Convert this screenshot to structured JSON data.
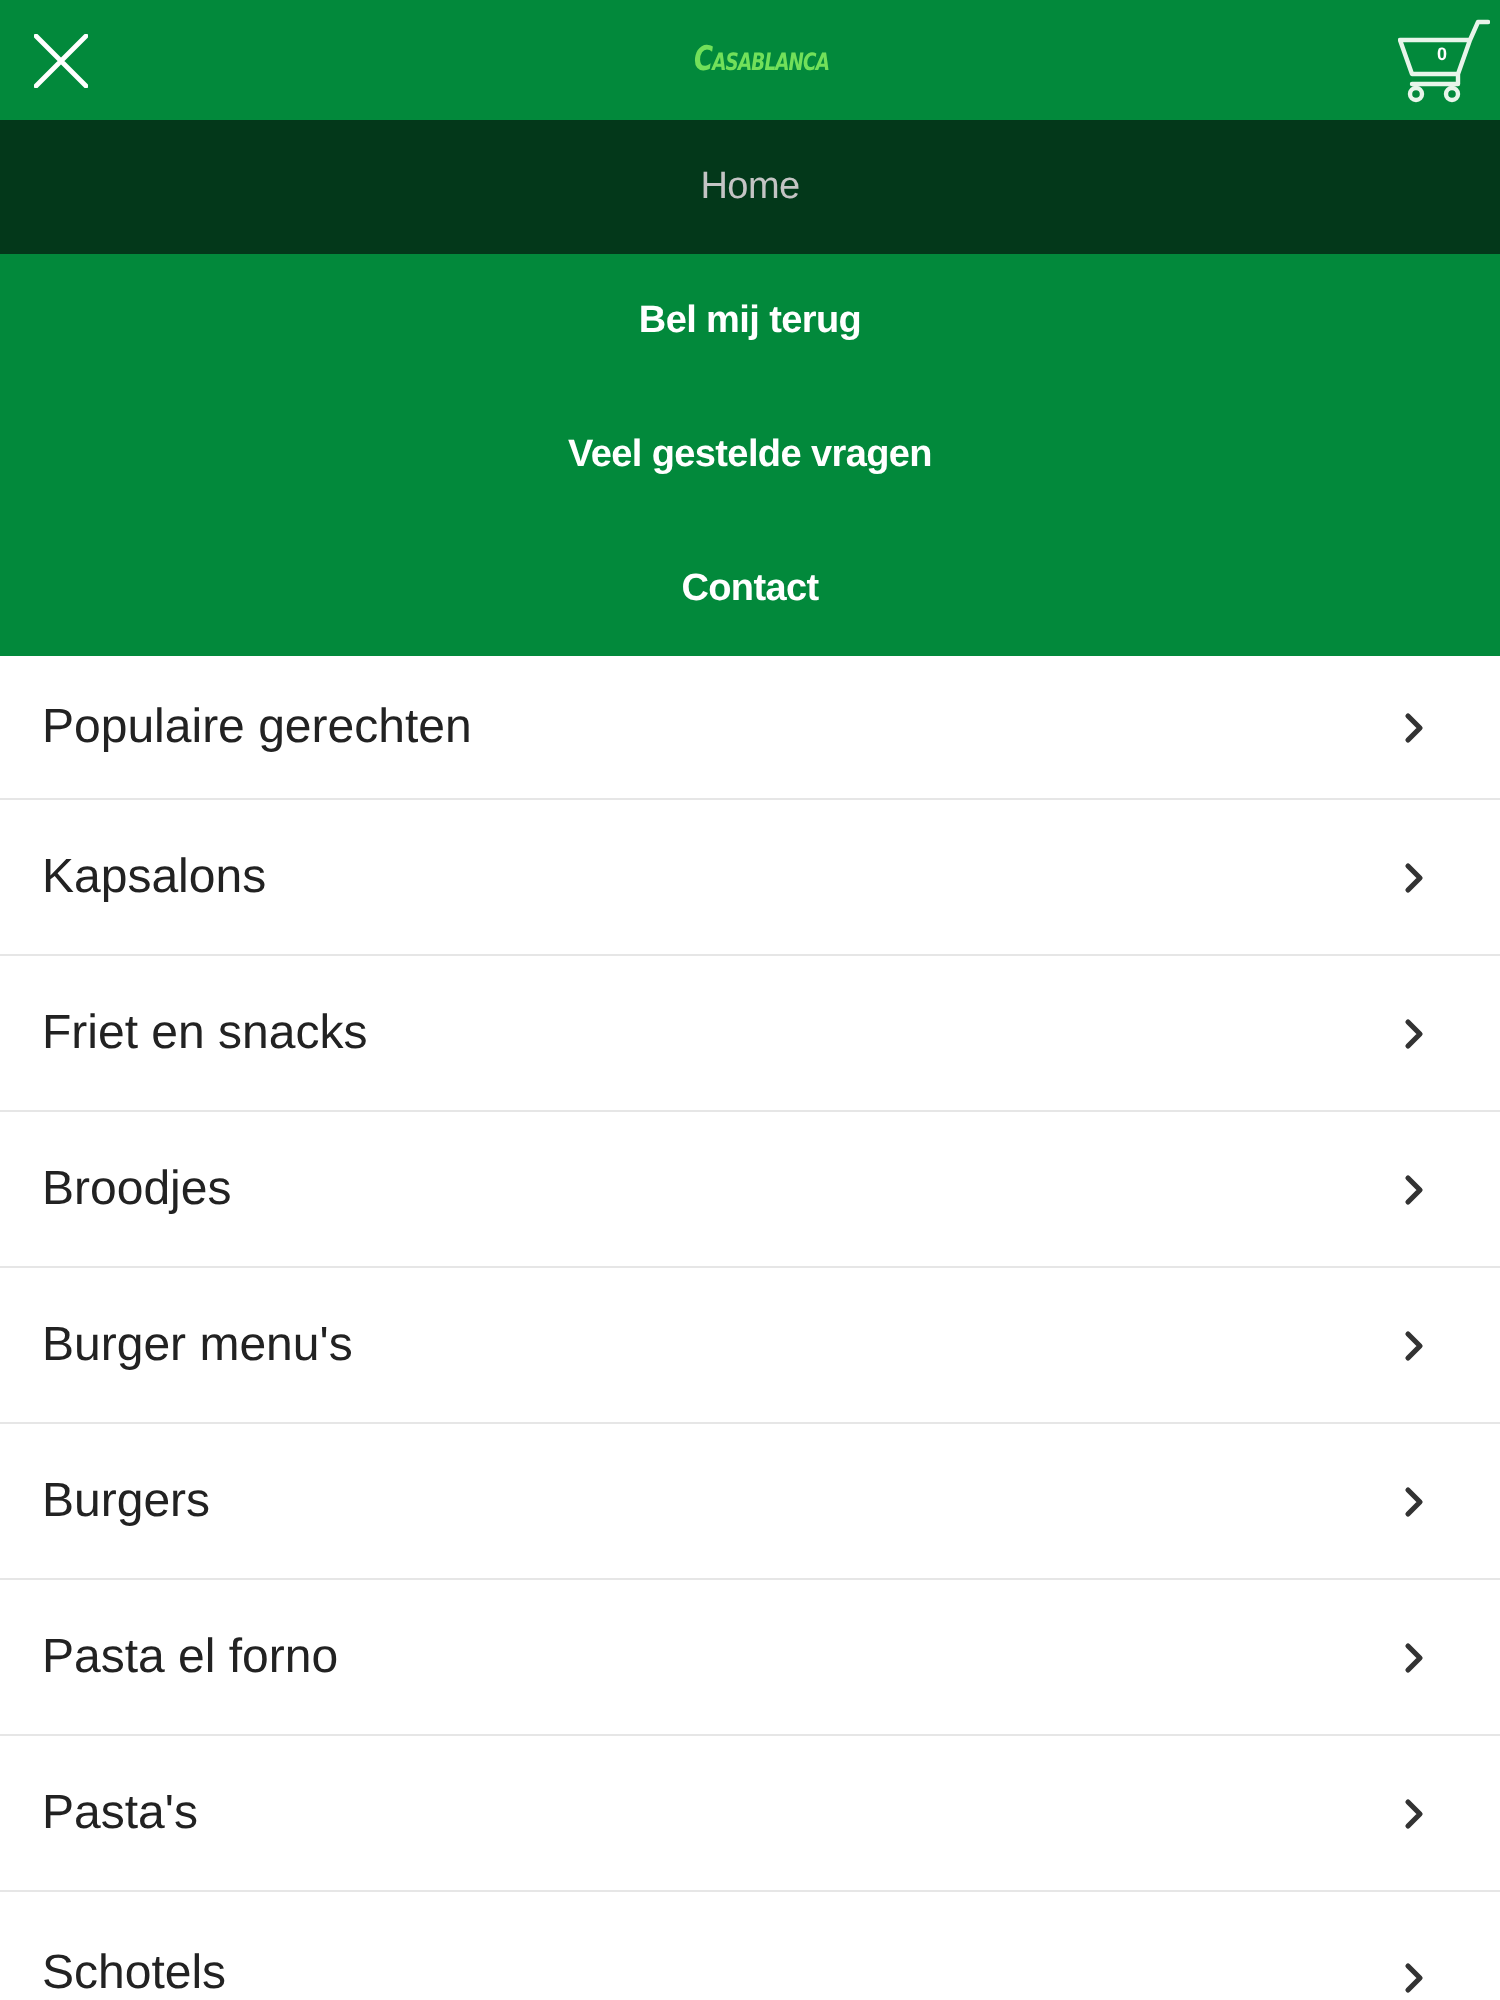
{
  "header": {
    "logo": "CASABLANCA",
    "cart_count": "0"
  },
  "nav": {
    "items": [
      {
        "label": "Home",
        "selected": true
      },
      {
        "label": "Bel mij terug",
        "selected": false
      },
      {
        "label": "Veel gestelde vragen",
        "selected": false
      },
      {
        "label": "Contact",
        "selected": false
      }
    ]
  },
  "categories": {
    "items": [
      {
        "label": "Populaire gerechten"
      },
      {
        "label": "Kapsalons"
      },
      {
        "label": "Friet en snacks"
      },
      {
        "label": "Broodjes"
      },
      {
        "label": "Burger menu's"
      },
      {
        "label": "Burgers"
      },
      {
        "label": "Pasta el forno"
      },
      {
        "label": "Pasta's"
      },
      {
        "label": "Schotels"
      }
    ]
  }
}
